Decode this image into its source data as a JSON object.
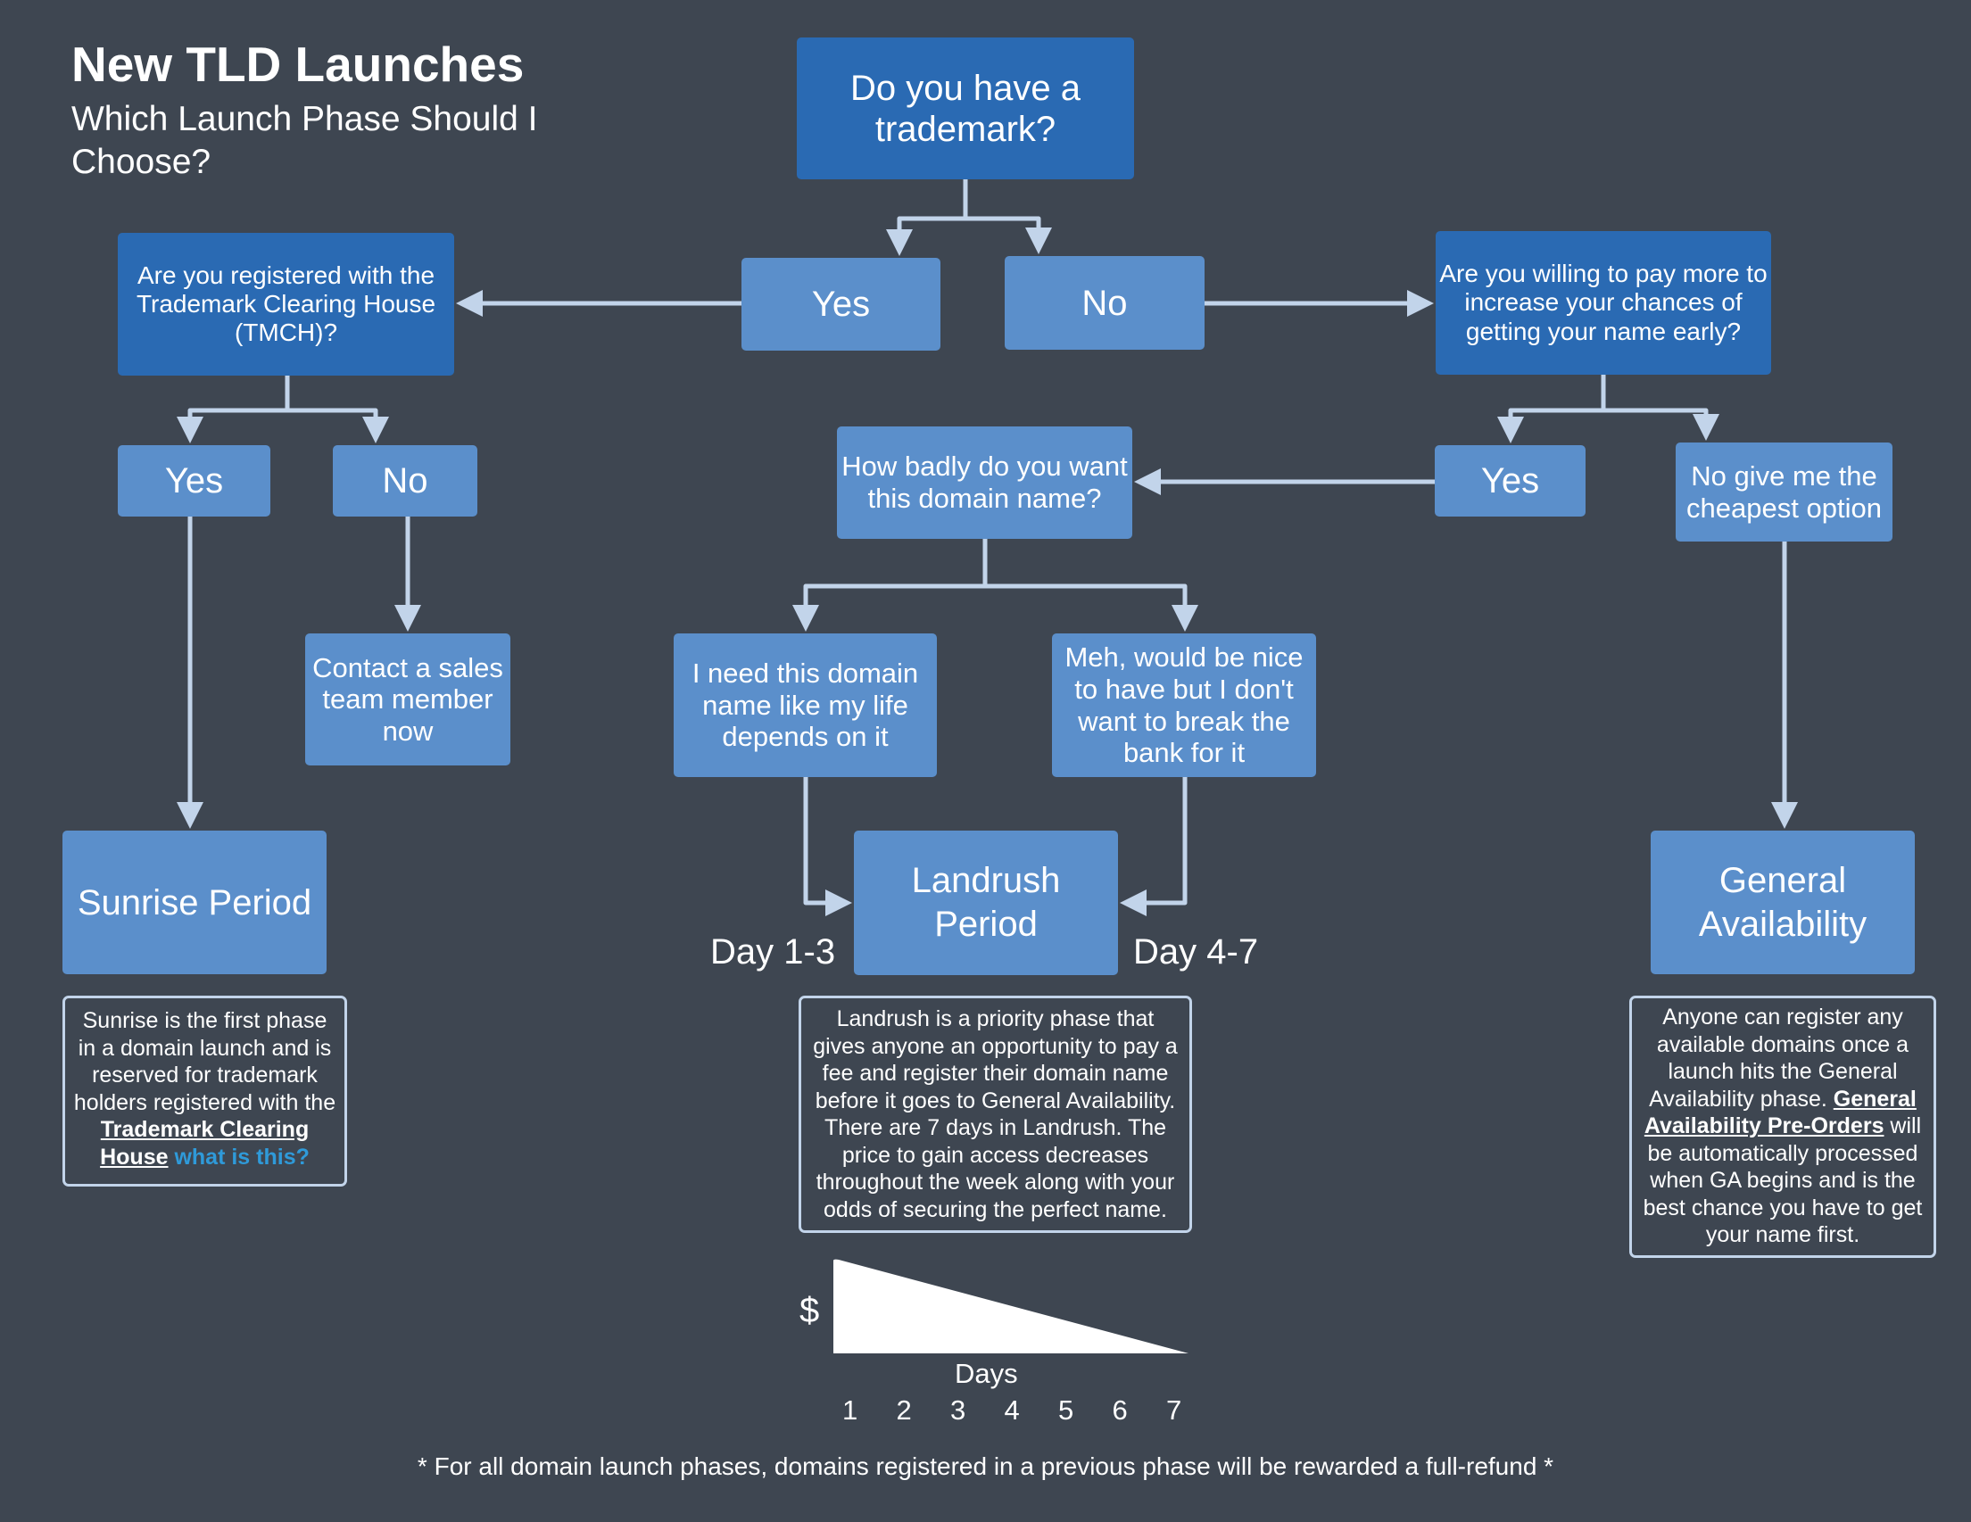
{
  "header": {
    "title": "New TLD Launches",
    "subtitle": "Which Launch Phase Should I Choose?"
  },
  "nodes": {
    "q_trademark": "Do you have a trademark?",
    "yes_trademark": "Yes",
    "no_trademark": "No",
    "q_tmch": "Are you registered with the Trademark Clearing House (TMCH)?",
    "yes_tmch": "Yes",
    "no_tmch": "No",
    "contact_sales": "Contact a sales team member now",
    "q_pay_more": "Are you willing to pay more to increase your chances of getting your name early?",
    "yes_pay": "Yes",
    "no_cheapest": "No give me the cheapest option",
    "q_how_badly": "How badly do you want this domain name?",
    "need_it": "I need this domain name like my life depends on it",
    "meh": "Meh, would be nice to have but I don't want to break the bank for it",
    "sunrise": "Sunrise Period",
    "landrush": "Landrush Period",
    "general_availability": "General Availability"
  },
  "labels": {
    "day_1_3": "Day 1-3",
    "day_4_7": "Day 4-7"
  },
  "descriptions": {
    "sunrise": {
      "text": "Sunrise is the first phase in a domain launch and is reserved for trademark holders registered with the ",
      "link_text": "Trademark Clearing House",
      "help_link": "what is this?"
    },
    "landrush": {
      "text": "Landrush is a priority phase that gives anyone an opportunity to pay a fee and register their domain name before it goes to General Availability. There are 7 days in Landrush. The price to gain access decreases throughout the week along with your odds of securing the perfect name."
    },
    "general_availability": {
      "text_before": "Anyone can register any available domains once a launch hits the General Availability phase. ",
      "link_text": "General Availability Pre-Orders",
      "text_after": " will be automatically processed when GA begins and is the best chance you have to get your name first."
    }
  },
  "price_chart": {
    "y_label": "$",
    "x_label": "Days",
    "days": [
      "1",
      "2",
      "3",
      "4",
      "5",
      "6",
      "7"
    ],
    "trend": "decreasing"
  },
  "footer": "* For all domain launch phases, domains registered in a previous phase will be rewarded a full-refund *",
  "colors": {
    "background": "#3e4651",
    "question_box": "#2a6ab3",
    "answer_box": "#5b8fcb",
    "connector": "#c2d4ea",
    "help_link": "#2f9ad9"
  }
}
